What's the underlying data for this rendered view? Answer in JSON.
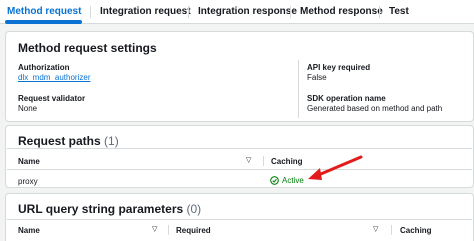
{
  "tabs": [
    {
      "label": "Method request",
      "active": true
    },
    {
      "label": "Integration request",
      "active": false
    },
    {
      "label": "Integration response",
      "active": false
    },
    {
      "label": "Method response",
      "active": false
    },
    {
      "label": "Test",
      "active": false
    }
  ],
  "settings": {
    "title": "Method request settings",
    "authorization_label": "Authorization",
    "authorization_value": "dlx_mdm_authorizer",
    "api_key_label": "API key required",
    "api_key_value": "False",
    "validator_label": "Request validator",
    "validator_value": "None",
    "sdk_label": "SDK operation name",
    "sdk_value": "Generated based on method and path"
  },
  "request_paths": {
    "title": "Request paths",
    "count": "(1)",
    "columns": [
      "Name",
      "Caching"
    ],
    "rows": [
      {
        "name": "proxy",
        "caching": "Active"
      }
    ]
  },
  "query_params": {
    "title": "URL query string parameters",
    "count": "(0)",
    "columns": [
      "Name",
      "Required",
      "Caching"
    ]
  },
  "colors": {
    "accent": "#0972d3",
    "success": "#037f0c",
    "annotation_arrow": "#e31b1b"
  },
  "icons": [
    "sort-caret-icon",
    "status-check-icon",
    "annotation-arrow"
  ]
}
